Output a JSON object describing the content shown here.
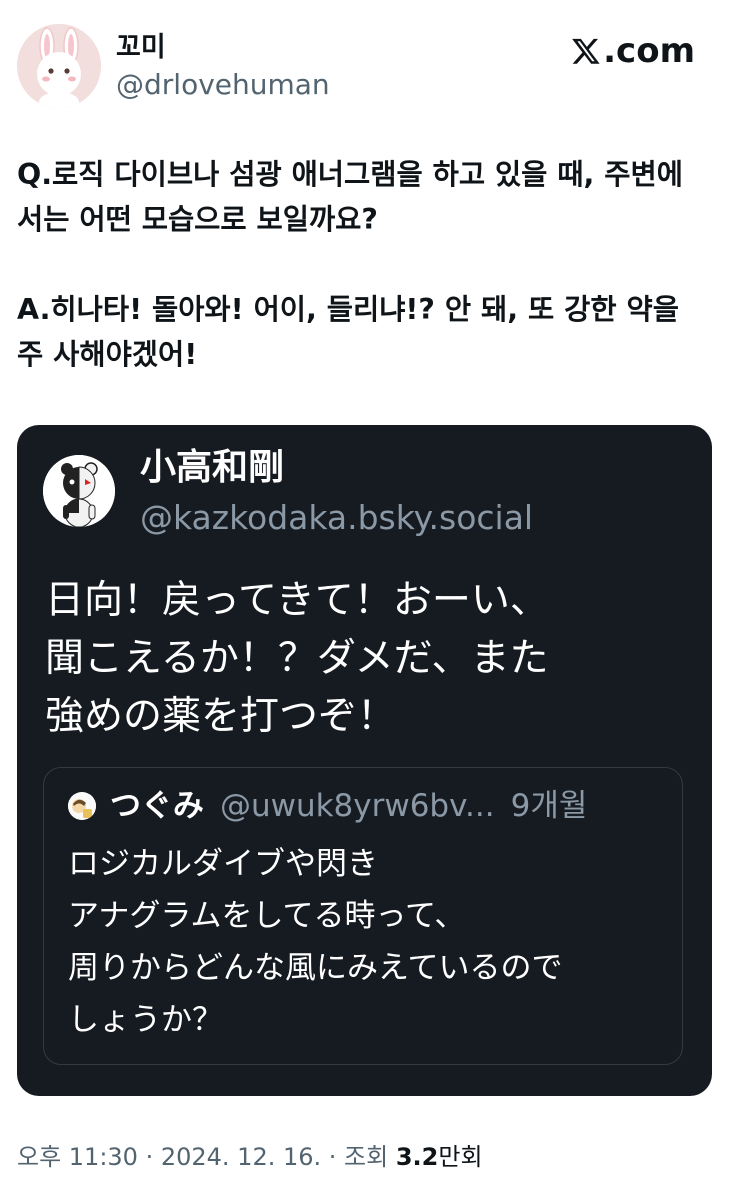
{
  "author": {
    "display_name": "꼬미",
    "handle": "@drlovehuman",
    "avatar_icon": "bunny-avatar-icon"
  },
  "brand": {
    "label": ".com",
    "icon": "x-logo-icon"
  },
  "tweet": {
    "lines": [
      "Q.로직 다이브나 섬광 애너그램을 하고 있을 때, 주변에 서는 어떤 모습으로 보일까요?",
      "A.히나타! 돌아와! 어이, 들리냐!? 안 돼, 또 강한 약을 주 사해야겠어!"
    ]
  },
  "embed": {
    "author_name": "小高和剛",
    "author_handle": "@kazkodaka.bsky.social",
    "avatar_icon": "monokuma-avatar-icon",
    "text_lines": [
      "日向！戻ってきて！おーい、",
      "聞こえるか！？ダメだ、また",
      "強めの薬を打つぞ！"
    ],
    "quote": {
      "author_name": "つぐみ",
      "author_handle": "@uwuk8yrw6bv...",
      "time": "9개월",
      "avatar_icon": "small-avatar-icon",
      "text_lines": [
        "ロジカルダイブや閃き",
        "アナグラムをしてる時って、",
        "周りからどんな風にみえているので",
        "しょうか？"
      ]
    }
  },
  "meta": {
    "time": "오후 11:30",
    "separator": " · ",
    "date": "2024. 12. 16.",
    "views_prefix": "조회 ",
    "views_count": "3.2",
    "views_unit": "만회"
  },
  "colors": {
    "text": "#0f1419",
    "muted": "#536471",
    "card_bg": "#161b22",
    "card_muted": "#8b98a5"
  }
}
